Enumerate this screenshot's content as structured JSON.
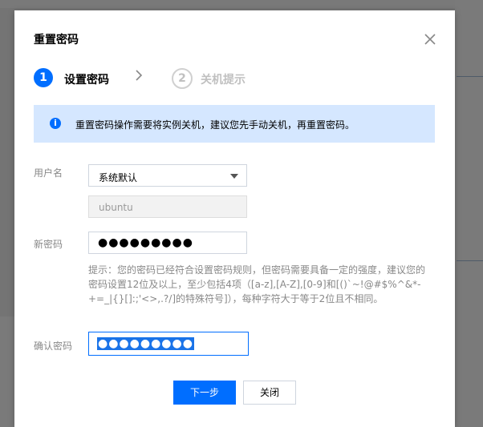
{
  "dialog": {
    "title": "重置密码",
    "close_icon": "close-icon"
  },
  "steps": [
    {
      "number": "1",
      "label": "设置密码",
      "state": "active"
    },
    {
      "number": "2",
      "label": "关机提示",
      "state": "inactive"
    }
  ],
  "notice": {
    "icon": "info-icon",
    "text": "重置密码操作需要将实例关机，建议您先手动关机，再重置密码。"
  },
  "form": {
    "username_label": "用户名",
    "username_select_value": "系统默认",
    "username_readonly_value": "ubuntu",
    "new_password_label": "新密码",
    "new_password_value": "●●●●●●●●●",
    "hint": "提示：您的密码已经符合设置密码规则，但密码需要具备一定的强度，建议您的密码设置12位及以上，至少包括4项（[a-z],[A-Z],[0-9]和[()`~!@#$%^&*-+=_|{}[]:;'<>,.?/]的特殊符号]），每种字符大于等于2位且不相同。",
    "confirm_password_label": "确认密码",
    "confirm_password_value": "●●●●●●●●●"
  },
  "buttons": {
    "next": "下一步",
    "close": "关闭"
  },
  "colors": {
    "primary": "#006eff",
    "notice_bg": "#d5e7ff"
  }
}
